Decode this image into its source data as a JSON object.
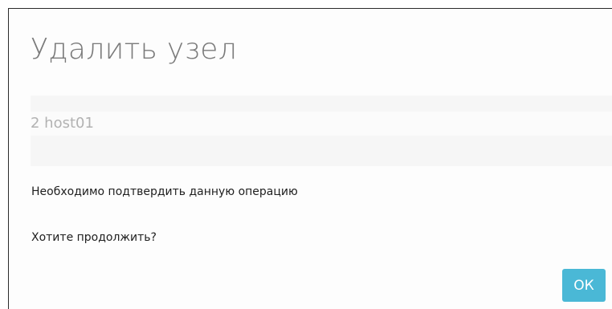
{
  "dialog": {
    "title": "Удалить узел",
    "item": "2 host01",
    "message_line1": "Необходимо подтвердить данную операцию",
    "message_line2": "Хотите продолжить?",
    "ok_label": "ОК",
    "accent_color": "#4ab8d6"
  }
}
